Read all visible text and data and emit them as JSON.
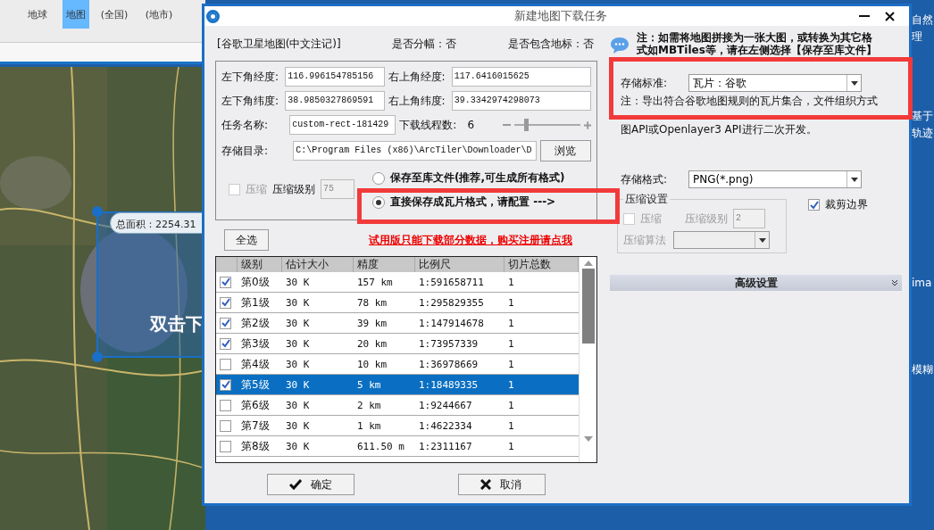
{
  "ribbon": {
    "items": [
      {
        "label": "地球",
        "selected": false
      },
      {
        "label": "地图",
        "selected": true
      },
      {
        "label": "(全国)",
        "selected": false
      },
      {
        "label": "(地市)",
        "selected": false
      }
    ]
  },
  "map": {
    "kind": "picture",
    "area_label": "总面积：2254.31",
    "hint": "双击下"
  },
  "desktop": {
    "icons": [
      {
        "label": "自然"
      },
      {
        "label": "理"
      },
      {
        "label": "基于"
      },
      {
        "label": "轨迹"
      },
      {
        "label": "ima"
      },
      {
        "label": "模糊"
      }
    ]
  },
  "dialog": {
    "title": "新建地图下载任务",
    "source": "[谷歌卫星地图(中文注记)]",
    "split": "是否分幅：否",
    "landmark": "是否包含地标：否",
    "fields": [
      {
        "label": "左下角经度:",
        "value": "116.996154785156"
      },
      {
        "label": "右上角经度:",
        "value": "117.6416015625"
      },
      {
        "label": "左下角纬度:",
        "value": "38.9850327869591"
      },
      {
        "label": "右上角纬度:",
        "value": "39.3342974298073"
      }
    ],
    "task_name": {
      "label": "任务名称:",
      "value": "custom-rect-181429"
    },
    "threads": {
      "label": "下载线程数:",
      "value": "6",
      "level": 0.15
    },
    "directory": {
      "label": "存储目录:",
      "value": "C:\\Program Files (x86)\\ArcTiler\\Downloader\\D",
      "button": "浏览"
    },
    "compress": {
      "label": "压缩",
      "checked": false,
      "disabled": true,
      "level_label": "压缩级别",
      "level_value": "75"
    },
    "save_modes": [
      {
        "label": "保存至库文件(推荐,可生成所有格式)",
        "selected": false
      },
      {
        "label": "直接保存成瓦片格式，请配置 --->",
        "selected": true
      }
    ],
    "select_all": "全选",
    "trial_link": "试用版只能下载部分数据，购买注册请点我",
    "table": {
      "columns": [
        "级别",
        "估计大小",
        "精度",
        "比例尺",
        "切片总数"
      ],
      "rows": [
        {
          "checked": true,
          "selected": false,
          "cells": [
            "第0级",
            "30 K",
            "157 km",
            "1:591658711",
            "1"
          ]
        },
        {
          "checked": true,
          "selected": false,
          "cells": [
            "第1级",
            "30 K",
            "78 km",
            "1:295829355",
            "1"
          ]
        },
        {
          "checked": true,
          "selected": false,
          "cells": [
            "第2级",
            "30 K",
            "39 km",
            "1:147914678",
            "1"
          ]
        },
        {
          "checked": true,
          "selected": false,
          "cells": [
            "第3级",
            "30 K",
            "20 km",
            "1:73957339",
            "1"
          ]
        },
        {
          "checked": false,
          "selected": false,
          "cells": [
            "第4级",
            "30 K",
            "10 km",
            "1:36978669",
            "1"
          ]
        },
        {
          "checked": true,
          "selected": true,
          "cells": [
            "第5级",
            "30 K",
            "5 km",
            "1:18489335",
            "1"
          ]
        },
        {
          "checked": false,
          "selected": false,
          "cells": [
            "第6级",
            "30 K",
            "2 km",
            "1:9244667",
            "1"
          ]
        },
        {
          "checked": false,
          "selected": false,
          "cells": [
            "第7级",
            "30 K",
            "1 km",
            "1:4622334",
            "1"
          ]
        },
        {
          "checked": false,
          "selected": false,
          "cells": [
            "第8级",
            "30 K",
            "611.50 m",
            "1:2311167",
            "1"
          ]
        }
      ]
    },
    "ok": "确定",
    "cancel": "取消",
    "note": "注：如需将地图拼接为一张大图，或转换为其它格式如MBTiles等，请在左侧选择【保存至库文件】",
    "standard": {
      "label": "存储标准:",
      "value": "瓦片：谷歌"
    },
    "standard_note": [
      "注：导出符合谷歌地图规则的瓦片集合，文件组织方式",
      "图API或Openlayer3  API进行二次开发。"
    ],
    "format": {
      "label": "存储格式:",
      "value": "PNG(*.png)"
    },
    "compression_group": {
      "title": "压缩设置",
      "compress_label": "压缩",
      "compress_checked": false,
      "level_label": "压缩级别",
      "level_value": "2",
      "algo_label": "压缩算法",
      "disabled": true
    },
    "crop": {
      "label": "裁剪边界",
      "checked": true
    },
    "advanced": "高级设置"
  }
}
